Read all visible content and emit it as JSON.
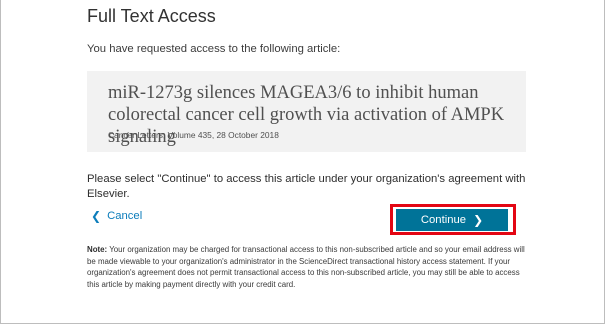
{
  "page": {
    "title": "Full Text Access",
    "intro": "You have requested access to the following article:"
  },
  "article": {
    "title": "miR-1273g silences MAGEA3/6 to inhibit human colorectal cancer cell growth via activation of AMPK signaling",
    "source": "Cancer Letters, Volume 435, 28 October 2018"
  },
  "instruction": "Please select \"Continue\" to access this article under your organization's agreement with Elsevier.",
  "actions": {
    "cancel_label": "Cancel",
    "cancel_icon": "chevron-left-icon",
    "continue_label": "Continue",
    "continue_icon": "chevron-right-icon"
  },
  "note": {
    "label": "Note:",
    "text": "Your organization may be charged for transactional access to this non-subscribed article and so your email address will be made viewable to your organization's administrator in the ScienceDirect transactional history access statement. If your organization's agreement does not permit transactional access to this non-subscribed article, you may still be able to access this article by making payment directly with your credit card."
  },
  "colors": {
    "accent": "#007398",
    "link": "#0c7dbb",
    "highlight": "#e30613",
    "article_box": "#f2f2f2"
  }
}
